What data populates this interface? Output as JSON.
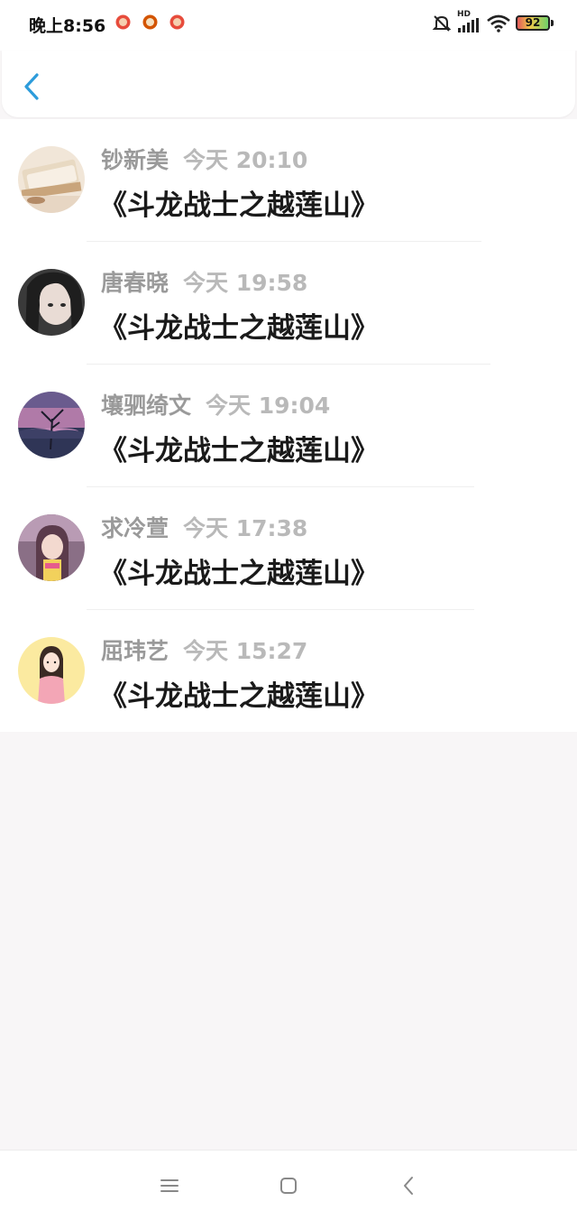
{
  "status_bar": {
    "time": "晚上8:56",
    "notification_icons": [
      "app-notification-icon",
      "app-notification-icon",
      "app-notification-icon"
    ],
    "network_label": "HD",
    "battery_level": "92"
  },
  "header": {
    "back_icon": "chevron-left-icon",
    "accent_color": "#2d9cdb"
  },
  "messages": [
    {
      "name": "钞新美",
      "time": "今天 20:10",
      "text": "《斗龙战士之越莲山》"
    },
    {
      "name": "唐春晓",
      "time": "今天 19:58",
      "text": "《斗龙战士之越莲山》"
    },
    {
      "name": "壤驷绮文",
      "time": "今天 19:04",
      "text": "《斗龙战士之越莲山》"
    },
    {
      "name": "求冷萱",
      "time": "今天 17:38",
      "text": "《斗龙战士之越莲山》"
    },
    {
      "name": "屈玮艺",
      "time": "今天 15:27",
      "text": "《斗龙战士之越莲山》"
    }
  ],
  "nav_bar": {
    "icons": [
      "menu-icon",
      "home-icon",
      "back-icon"
    ]
  }
}
